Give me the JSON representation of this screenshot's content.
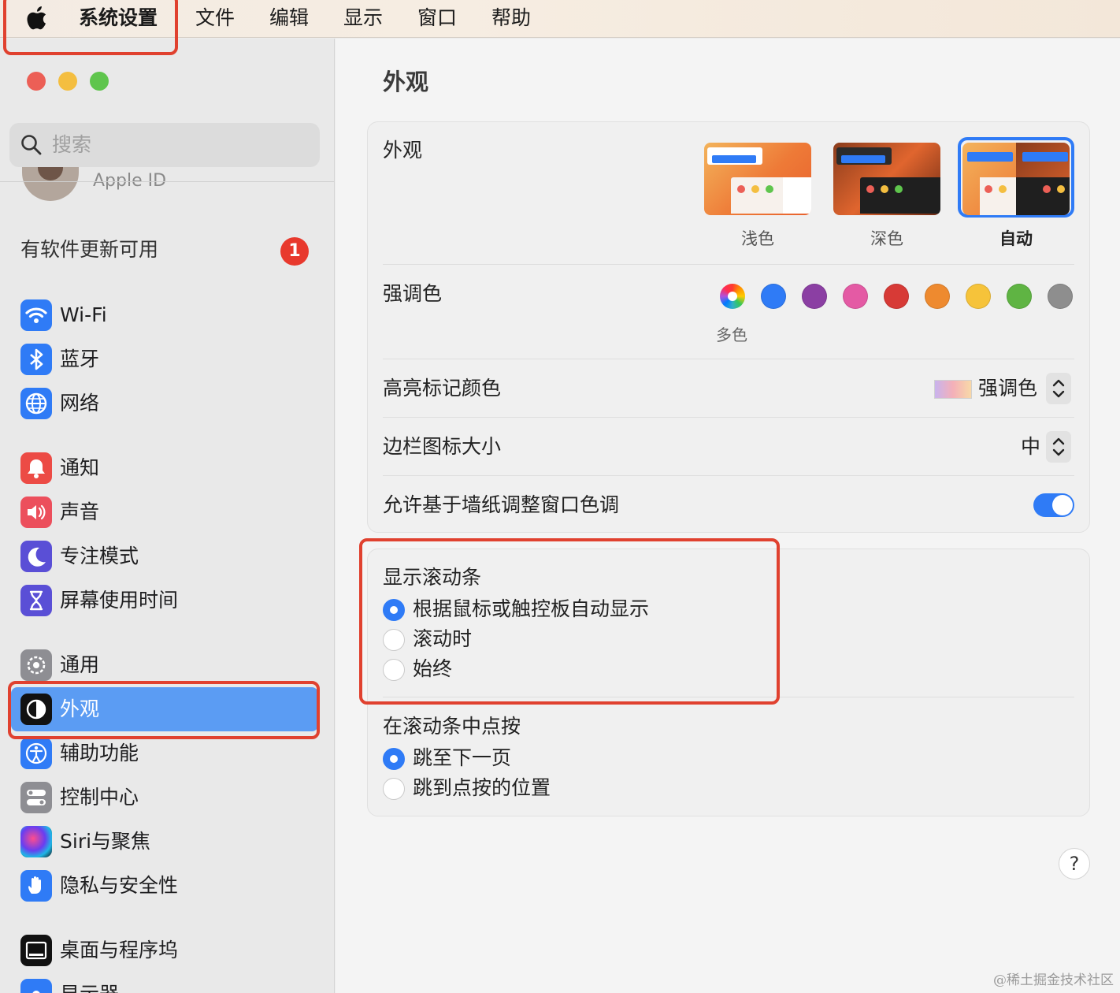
{
  "menubar": {
    "app": "系统设置",
    "items": [
      "文件",
      "编辑",
      "显示",
      "窗口",
      "帮助"
    ]
  },
  "sidebar": {
    "search_placeholder": "搜索",
    "apple_id": "Apple ID",
    "update_label": "有软件更新可用",
    "update_count": "1",
    "items": [
      {
        "label": "Wi-Fi",
        "icon": "wifi-icon"
      },
      {
        "label": "蓝牙",
        "icon": "bluetooth-icon"
      },
      {
        "label": "网络",
        "icon": "network-globe-icon"
      },
      {
        "label": "通知",
        "icon": "bell-icon"
      },
      {
        "label": "声音",
        "icon": "speaker-icon"
      },
      {
        "label": "专注模式",
        "icon": "moon-icon"
      },
      {
        "label": "屏幕使用时间",
        "icon": "hourglass-icon"
      },
      {
        "label": "通用",
        "icon": "gear-icon"
      },
      {
        "label": "外观",
        "icon": "appearance-icon",
        "active": true
      },
      {
        "label": "辅助功能",
        "icon": "accessibility-icon"
      },
      {
        "label": "控制中心",
        "icon": "control-center-icon"
      },
      {
        "label": "Siri与聚焦",
        "icon": "siri-icon"
      },
      {
        "label": "隐私与安全性",
        "icon": "hand-icon"
      },
      {
        "label": "桌面与程序坞",
        "icon": "dock-icon"
      },
      {
        "label": "显示器",
        "icon": "display-icon"
      }
    ]
  },
  "main": {
    "title": "外观",
    "appearance": {
      "label": "外观",
      "options": [
        {
          "label": "浅色",
          "selected": false
        },
        {
          "label": "深色",
          "selected": false
        },
        {
          "label": "自动",
          "selected": true
        }
      ]
    },
    "accent": {
      "label": "强调色",
      "multicolor_caption": "多色",
      "colors": [
        "multicolor",
        "#2f7bf6",
        "#8b3fa3",
        "#e45aa4",
        "#d73a36",
        "#ee8a2f",
        "#f6c33a",
        "#5fb443",
        "#8e8e8e"
      ]
    },
    "highlight": {
      "label": "高亮标记颜色",
      "value": "强调色"
    },
    "sidebar_icon_size": {
      "label": "边栏图标大小",
      "value": "中"
    },
    "tinting": {
      "label": "允许基于墙纸调整窗口色调",
      "on": true
    },
    "scrollbars": {
      "label": "显示滚动条",
      "options": [
        {
          "label": "根据鼠标或触控板自动显示",
          "selected": true
        },
        {
          "label": "滚动时",
          "selected": false
        },
        {
          "label": "始终",
          "selected": false
        }
      ]
    },
    "click_scrollbar": {
      "label": "在滚动条中点按",
      "options": [
        {
          "label": "跳至下一页",
          "selected": true
        },
        {
          "label": "跳到点按的位置",
          "selected": false
        }
      ]
    },
    "help": "?"
  },
  "watermark": "@稀土掘金技术社区"
}
